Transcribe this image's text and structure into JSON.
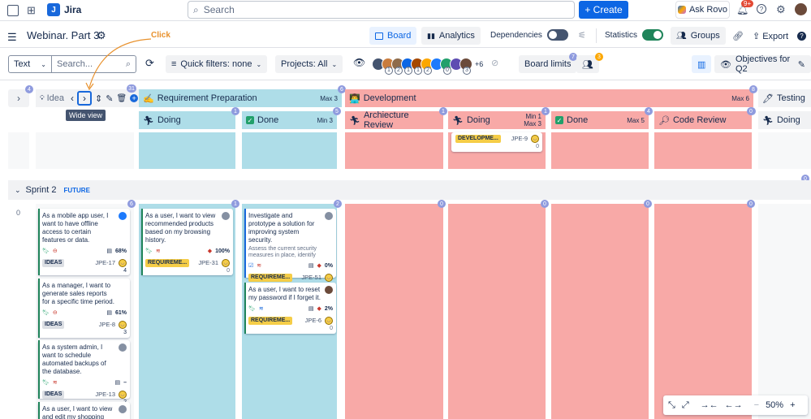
{
  "topnav": {
    "app_name": "Jira",
    "search_placeholder": "Search",
    "create_label": "+ Create",
    "rovo_label": "Ask Rovo",
    "notif_badge": "9+"
  },
  "titlebar": {
    "board_title": "Webinar. Part 3",
    "tab_board": "Board",
    "tab_analytics": "Analytics",
    "dependencies_label": "Dependencies",
    "statistics_label": "Statistics",
    "groups_label": "Groups",
    "export_label": "Export"
  },
  "filterbar": {
    "text_select": "Text",
    "search_placeholder": "Search...",
    "quick_filters": "Quick filters: none",
    "projects": "Projects: All",
    "avatar_more": "+6",
    "avatar_counts": [
      "1",
      "2",
      "1",
      "1",
      "2",
      "0",
      "3"
    ],
    "board_limits": "Board limits",
    "board_limits_badge": "7",
    "people_badge": "3",
    "objectives": "Objectives for Q2"
  },
  "annotation": {
    "click_label": "Click",
    "tooltip": "Wide view"
  },
  "columns": {
    "ideas": {
      "label": "Idea",
      "count": "4"
    },
    "toolbar_count": "31",
    "req_prep": {
      "label": "Requirement Preparation",
      "limit": "Max 3",
      "count": "6"
    },
    "req_doing": {
      "label": "Doing",
      "count": "1"
    },
    "req_done": {
      "label": "Done",
      "limit": "Min 3",
      "count": "5"
    },
    "development": {
      "label": "Development",
      "limit": "Max 6",
      "count": "8"
    },
    "dev_arch": {
      "label": "Archiecture Review",
      "count": "1"
    },
    "dev_doing": {
      "label": "Doing",
      "limit_min": "Min 1",
      "limit_max": "Max 3",
      "count": "1"
    },
    "dev_done": {
      "label": "Done",
      "limit": "Max 5",
      "count": "4"
    },
    "dev_code": {
      "label": "Code Review",
      "count": "0"
    },
    "testing": {
      "label": "Testing",
      "count": "0"
    },
    "test_doing": {
      "label": "Doing"
    }
  },
  "top_lane": {
    "card": {
      "epic": "DEVELOPME...",
      "key": "JPE-9",
      "num": "0"
    }
  },
  "sprint": {
    "name": "Sprint 2",
    "tag": "FUTURE",
    "count": "0",
    "lane_count": "0",
    "col_counts": [
      "6",
      "1",
      "2",
      "0",
      "0",
      "0",
      "0"
    ]
  },
  "cards": {
    "c1": {
      "summary": "As a mobile app user, I want to have offline access to certain features or data.",
      "stat": "68%",
      "epic": "IDEAS",
      "key": "JPE-17",
      "num": "4"
    },
    "c2": {
      "summary": "As a manager, I want to generate sales reports for a specific time period.",
      "stat": "61%",
      "epic": "IDEAS",
      "key": "JPE-8",
      "num": "3"
    },
    "c3": {
      "summary": "As a system admin, I want to schedule automated backups of the database.",
      "stat": "–",
      "epic": "IDEAS",
      "key": "JPE-13",
      "num": "2"
    },
    "c4": {
      "summary": "As a user, I want to view and edit my shopping cart"
    },
    "c5": {
      "summary": "As a user, I want to view recommended products based on my browsing history.",
      "stat": "100%",
      "epic": "REQUIREME...",
      "key": "JPE-31",
      "num": "0"
    },
    "c6": {
      "summary": "Investigate and prototype a solution for improving system security.",
      "sub": "Assess the current security measures in place, identify",
      "stat": "0%",
      "epic": "REQUIREME...",
      "key": "JPE-51",
      "num": "0"
    },
    "c7": {
      "summary": "As a user, I want to reset my password if I forget it.",
      "stat": "2%",
      "epic": "REQUIREME...",
      "key": "JPE-6",
      "num": "0"
    }
  },
  "zoom": {
    "level": "50%"
  },
  "colors": {
    "req_bg": "#aedde8",
    "dev_bg": "#f8a9a7",
    "done_check": "#22a06b",
    "tooltip_bg": "#44546f",
    "annotation": "#e8912d"
  }
}
